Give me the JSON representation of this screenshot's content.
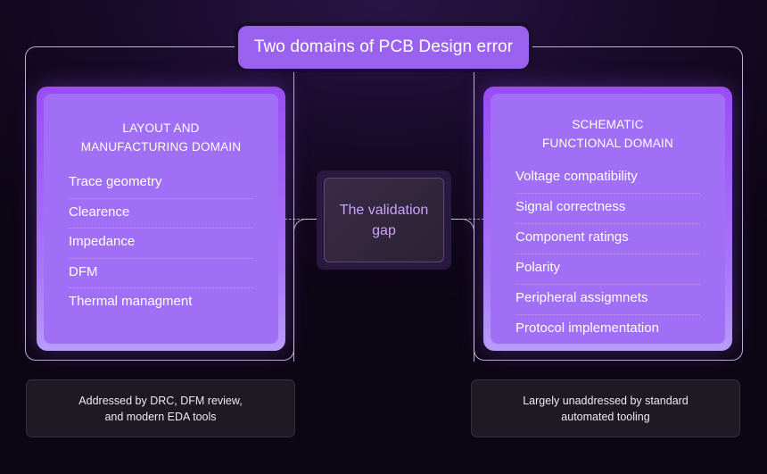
{
  "title": "Two domains of PCB Design error",
  "left_domain": {
    "title": "LAYOUT AND\nMANUFACTURING DOMAIN",
    "items": [
      "Trace geometry",
      "Clearence",
      "Impedance",
      "DFM",
      "Thermal managment"
    ],
    "note": "Addressed by DRC, DFM review,\nand modern EDA tools"
  },
  "right_domain": {
    "title": "SCHEMATIC\nFUNCTIONAL DOMAIN",
    "items": [
      "Voltage compatibility",
      "Signal correctness",
      "Component ratings",
      "Polarity",
      "Peripheral assigmnets",
      "Protocol implementation"
    ],
    "note": "Largely unaddressed by standard\nautomated tooling"
  },
  "gap": {
    "label": "The validation\ngap"
  },
  "colors": {
    "accent": "#9b62f0",
    "domain_fill": "#a06ff5",
    "gap_text": "#c9a4f7",
    "background": "#180a2a"
  }
}
